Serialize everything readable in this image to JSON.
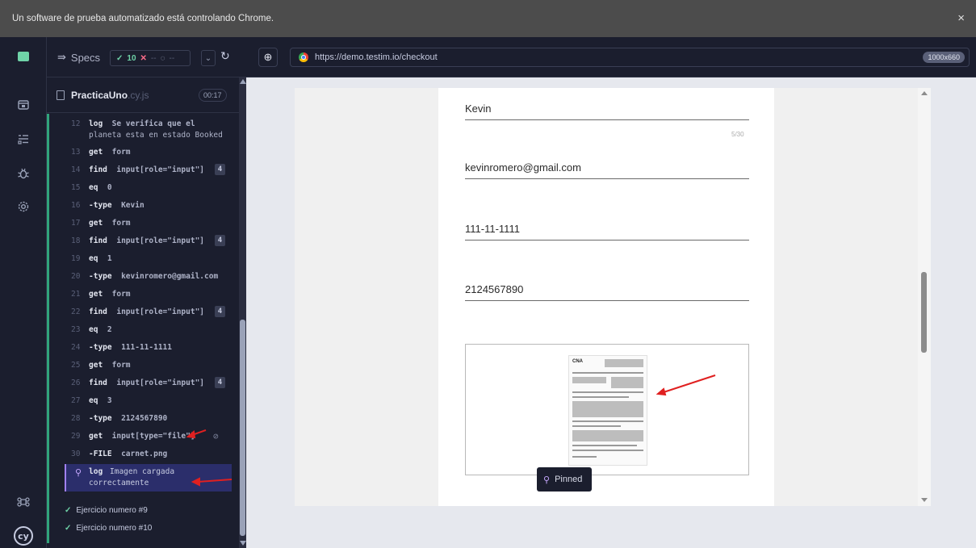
{
  "banner": {
    "text": "Un software de prueba automatizado está controlando Chrome.",
    "close": "×"
  },
  "specbar": {
    "specs_label": "Specs",
    "passed": "10",
    "failed": "--",
    "pending": "--",
    "chevron": "⌄",
    "reload": "↻"
  },
  "spec": {
    "name": "PracticaUno",
    "ext": ".cy.js",
    "duration": "00:17"
  },
  "commands": [
    {
      "num": "12",
      "kw": "log",
      "arg": "Se verifica que el",
      "line2": "planeta esta en estado Booked"
    },
    {
      "num": "13",
      "kw": "get",
      "arg": "form"
    },
    {
      "num": "14",
      "kw": "find",
      "arg": "input[role=\"input\"]",
      "badge": "4"
    },
    {
      "num": "15",
      "kw": "eq",
      "arg": "0"
    },
    {
      "num": "16",
      "kw": "-type",
      "arg": "Kevin"
    },
    {
      "num": "17",
      "kw": "get",
      "arg": "form"
    },
    {
      "num": "18",
      "kw": "find",
      "arg": "input[role=\"input\"]",
      "badge": "4"
    },
    {
      "num": "19",
      "kw": "eq",
      "arg": "1"
    },
    {
      "num": "20",
      "kw": "-type",
      "arg": "kevinromero@gmail.com"
    },
    {
      "num": "21",
      "kw": "get",
      "arg": "form"
    },
    {
      "num": "22",
      "kw": "find",
      "arg": "input[role=\"input\"]",
      "badge": "4"
    },
    {
      "num": "23",
      "kw": "eq",
      "arg": "2"
    },
    {
      "num": "24",
      "kw": "-type",
      "arg": "111-11-1111"
    },
    {
      "num": "25",
      "kw": "get",
      "arg": "form"
    },
    {
      "num": "26",
      "kw": "find",
      "arg": "input[role=\"input\"]",
      "badge": "4"
    },
    {
      "num": "27",
      "kw": "eq",
      "arg": "3"
    },
    {
      "num": "28",
      "kw": "-type",
      "arg": "2124567890"
    },
    {
      "num": "29",
      "kw": "get",
      "arg": "input[type=\"file\"]"
    },
    {
      "num": "30",
      "kw": "-FILE",
      "arg": "carnet.png"
    }
  ],
  "pinned_log": {
    "kw": "log",
    "line1": "Imagen cargada",
    "line2": "correctamente"
  },
  "tests": [
    {
      "label": "Ejercicio numero #9"
    },
    {
      "label": "Ejercicio numero #10"
    }
  ],
  "aut": {
    "url": "https://demo.testim.io/checkout",
    "viewport": "1000x660",
    "fields": [
      {
        "value": "Kevin"
      },
      {
        "value": "kevinromero@gmail.com"
      },
      {
        "value": "111-11-1111"
      },
      {
        "value": "2124567890"
      }
    ],
    "counter": "5/30",
    "doc_logo": "CNA",
    "pinned_tooltip": "Pinned"
  },
  "colors": {
    "pass": "#6fd3a8",
    "fail": "#ff6d8a",
    "pin": "#c6a8ff",
    "accent_row": "#2b2e6b",
    "arrow": "#e02020"
  }
}
